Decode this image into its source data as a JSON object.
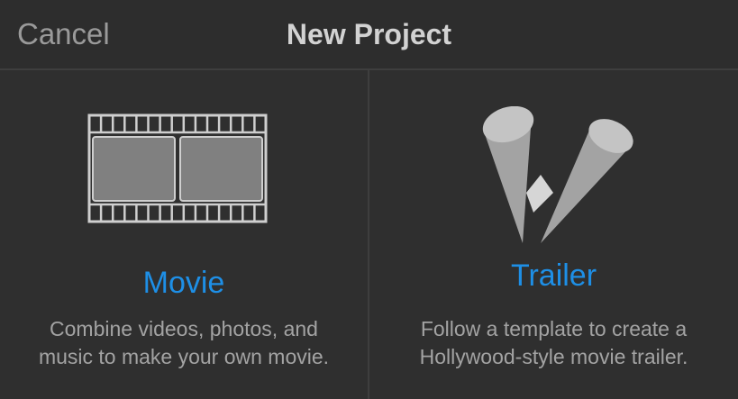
{
  "nav": {
    "cancel_label": "Cancel",
    "title": "New Project"
  },
  "options": [
    {
      "title": "Movie",
      "description_line1": "Combine videos, photos, and",
      "description_line2": "music to make your own movie.",
      "icon": "film-strip-icon"
    },
    {
      "title": "Trailer",
      "description_line1": "Follow a template to create a",
      "description_line2": "Hollywood-style movie trailer.",
      "icon": "spotlights-icon"
    }
  ],
  "colors": {
    "accent": "#1e8fe6",
    "background": "#2f2f2f",
    "text_secondary": "#a3a3a3",
    "divider": "#3e3e3e"
  }
}
